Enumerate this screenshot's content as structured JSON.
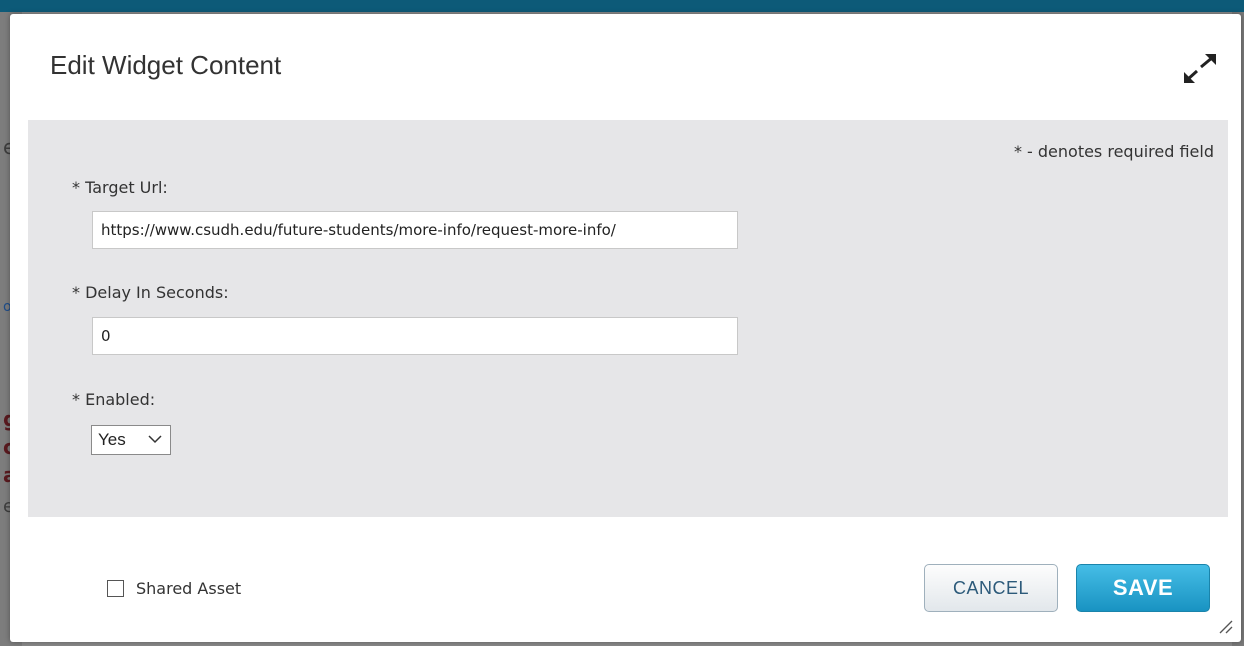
{
  "dialog": {
    "title": "Edit Widget Content",
    "expand_icon": "expand-arrows-icon"
  },
  "form": {
    "required_note": "* - denotes required field",
    "target_url": {
      "label": "* Target Url:",
      "value": "https://www.csudh.edu/future-students/more-info/request-more-info/"
    },
    "delay": {
      "label": "* Delay In Seconds:",
      "value": "0"
    },
    "enabled": {
      "label": "* Enabled:",
      "selected": "Yes"
    }
  },
  "footer": {
    "shared_asset_label": "Shared Asset",
    "shared_asset_checked": false,
    "cancel_label": "CANCEL",
    "save_label": "SAVE"
  },
  "colors": {
    "save_button": "#1993c2",
    "panel_background": "#e6e6e8",
    "backdrop": "#8a8a8a"
  }
}
